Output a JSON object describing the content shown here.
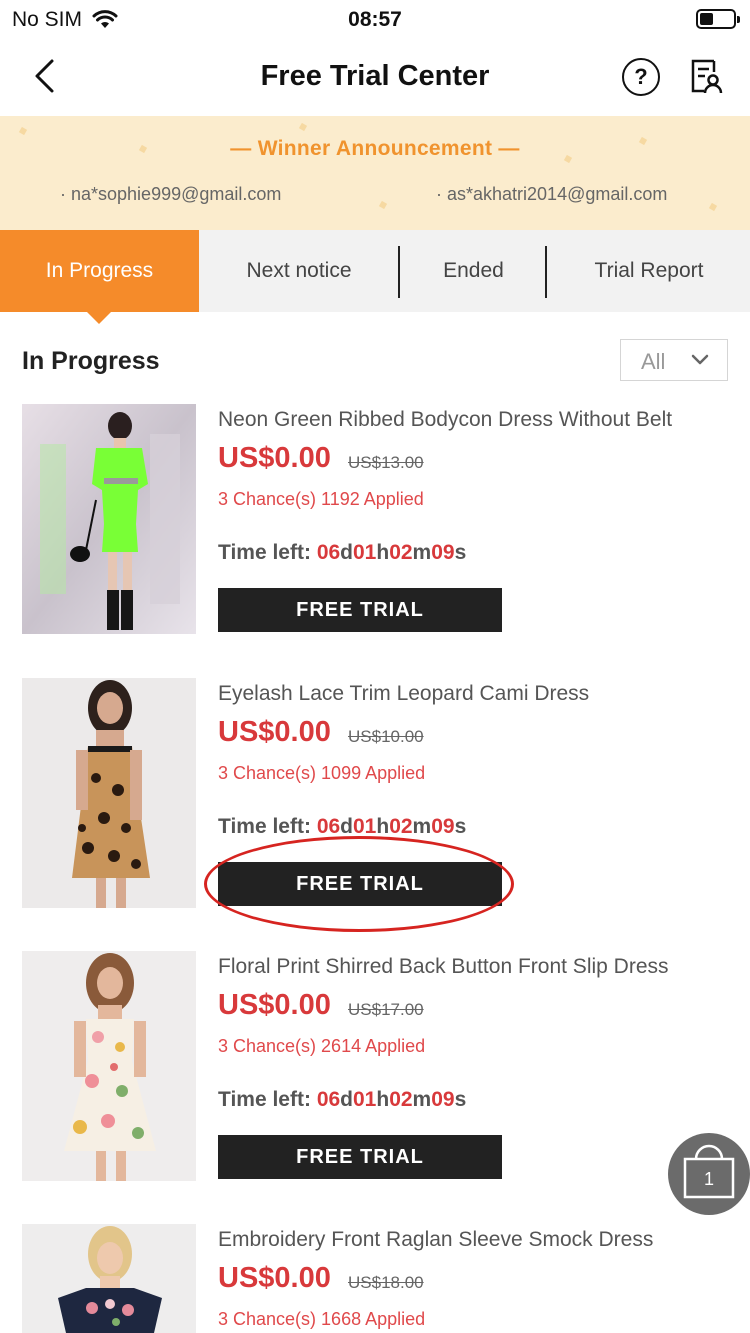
{
  "status_bar": {
    "carrier": "No SIM",
    "time": "08:57",
    "battery_level": 0.4
  },
  "nav": {
    "title": "Free Trial Center",
    "back_icon": "chevron-left-icon",
    "help_label": "?",
    "report_icon": "report-user-icon"
  },
  "announcement": {
    "title": "— Winner Announcement —",
    "winners": [
      "· na*sophie999@gmail.com",
      "· as*akhatri2014@gmail.com"
    ]
  },
  "tabs": [
    {
      "label": "In Progress",
      "active": true
    },
    {
      "label": "Next notice",
      "active": false
    },
    {
      "label": "Ended",
      "active": false
    },
    {
      "label": "Trial Report",
      "active": false
    }
  ],
  "section": {
    "title": "In Progress",
    "filter_value": "All"
  },
  "products": [
    {
      "name": "Neon Green Ribbed Bodycon Dress Without Belt",
      "price": "US$0.00",
      "original_price": "US$13.00",
      "chances": "3 Chance(s) 1192 Applied",
      "time_label": "Time left:",
      "time": {
        "d": "06",
        "h": "01",
        "m": "02",
        "s": "09"
      },
      "button": "FREE TRIAL"
    },
    {
      "name": "Eyelash Lace Trim Leopard Cami Dress",
      "price": "US$0.00",
      "original_price": "US$10.00",
      "chances": "3 Chance(s) 1099 Applied",
      "time_label": "Time left:",
      "time": {
        "d": "06",
        "h": "01",
        "m": "02",
        "s": "09"
      },
      "button": "FREE TRIAL"
    },
    {
      "name": "Floral Print Shirred Back Button Front Slip Dress",
      "price": "US$0.00",
      "original_price": "US$17.00",
      "chances": "3 Chance(s) 2614 Applied",
      "time_label": "Time left:",
      "time": {
        "d": "06",
        "h": "01",
        "m": "02",
        "s": "09"
      },
      "button": "FREE TRIAL"
    },
    {
      "name": "Embroidery Front Raglan Sleeve Smock Dress",
      "price": "US$0.00",
      "original_price": "US$18.00",
      "chances": "3 Chance(s) 1668 Applied"
    }
  ],
  "units": {
    "d": "d",
    "h": "h",
    "m": "m",
    "s": "s"
  },
  "cart": {
    "count": "1",
    "icon": "shopping-bag-icon"
  },
  "colors": {
    "accent_orange": "#f58b2a",
    "price_red": "#d8393b",
    "banner_bg": "#fbeccd",
    "button_dark": "#222222"
  }
}
